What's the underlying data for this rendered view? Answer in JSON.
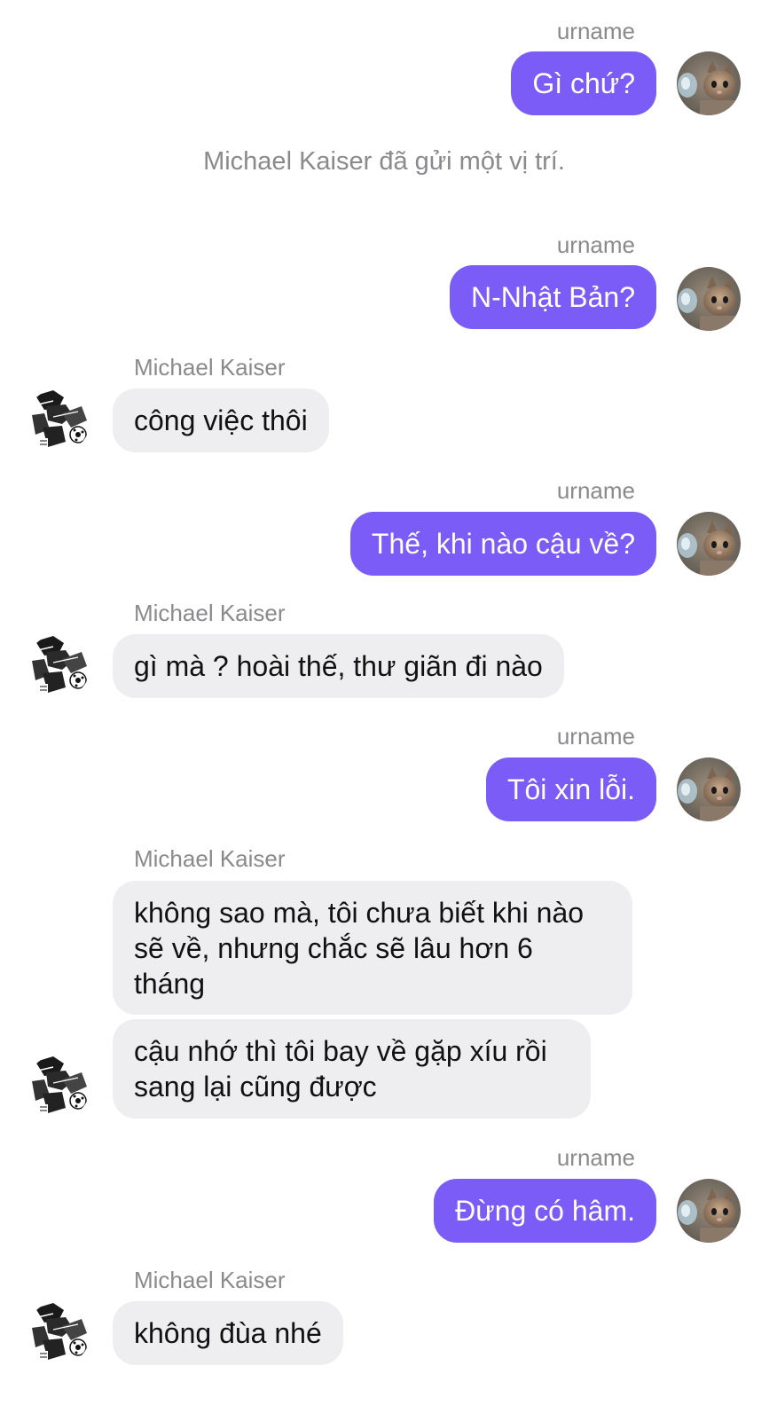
{
  "colors": {
    "outgoing_bubble": "#7b5cf6",
    "incoming_bubble": "#eeeef0",
    "meta_text": "#8a8a8e"
  },
  "icons": {
    "me_avatar": "kitten-avatar",
    "them_avatar": "manga-soccer-avatar"
  },
  "conversation": {
    "system_message": "Michael Kaiser đã gửi một vị trí.",
    "me_name": "urname",
    "them_name": "Michael Kaiser",
    "messages": [
      {
        "sender": "me",
        "text": "Gì chứ?"
      },
      {
        "sender": "me",
        "text": "N-Nhật Bản?"
      },
      {
        "sender": "them",
        "text": "công việc thôi"
      },
      {
        "sender": "me",
        "text": "Thế, khi nào cậu về?"
      },
      {
        "sender": "them",
        "text": "gì mà ? hoài thế, thư giãn đi nào"
      },
      {
        "sender": "me",
        "text": "Tôi xin lỗi."
      },
      {
        "sender": "them",
        "text": "không sao mà, tôi chưa biết khi nào sẽ về, nhưng chắc sẽ lâu hơn 6 tháng"
      },
      {
        "sender": "them",
        "text": "cậu nhớ thì tôi bay về gặp xíu rồi sang lại cũng được"
      },
      {
        "sender": "me",
        "text": "Đừng có hâm."
      },
      {
        "sender": "them",
        "text": "không đùa nhé"
      }
    ]
  }
}
